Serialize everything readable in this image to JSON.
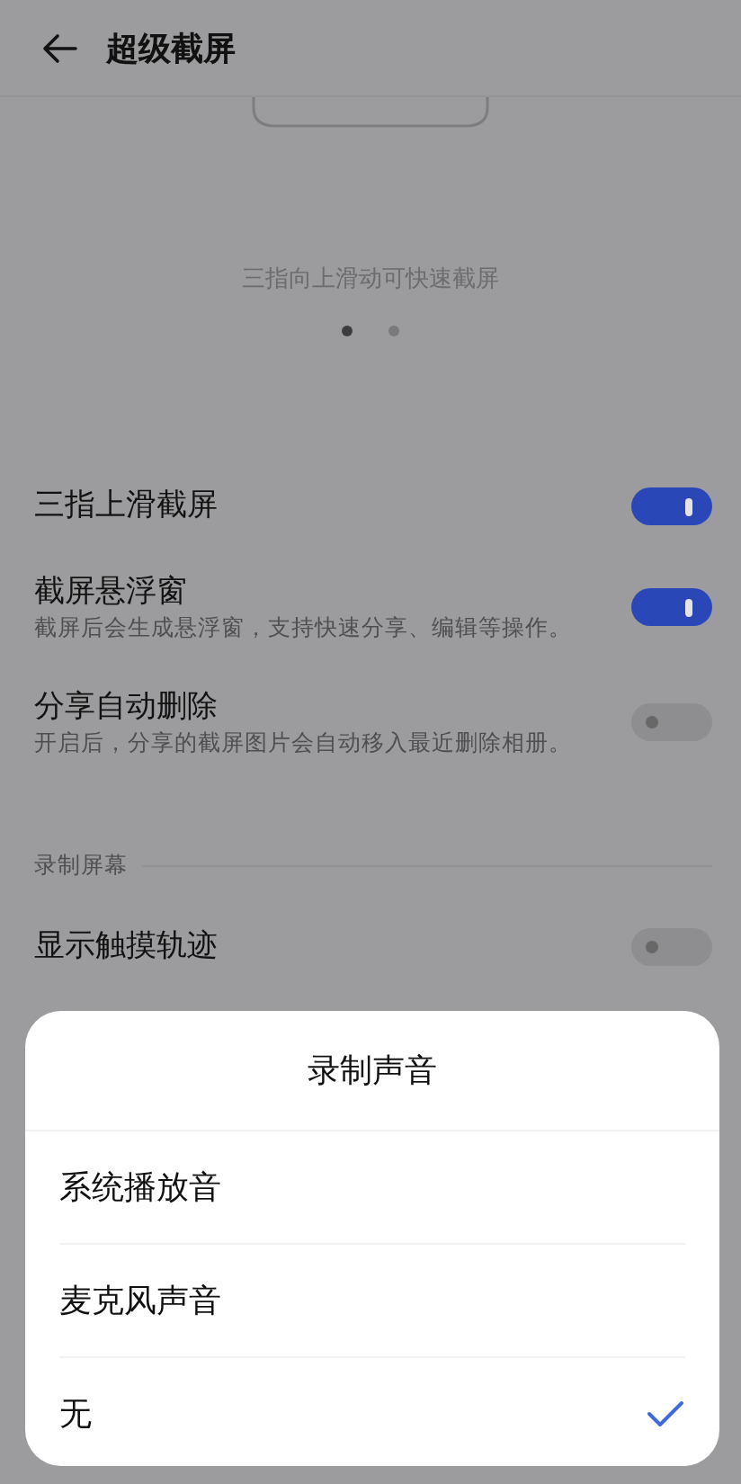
{
  "header": {
    "title": "超级截屏"
  },
  "preview": {
    "caption": "三指向上滑动可快速截屏",
    "pages": [
      {
        "selected": true
      },
      {
        "selected": false
      }
    ]
  },
  "settings": [
    {
      "kind": "toggle",
      "title": "三指上滑截屏",
      "on": true
    },
    {
      "kind": "toggle",
      "title": "截屏悬浮窗",
      "subtitle": "截屏后会生成悬浮窗，支持快速分享、编辑等操作。",
      "on": true
    },
    {
      "kind": "toggle",
      "title": "分享自动删除",
      "subtitle": "开启后，分享的截屏图片会自动移入最近删除相册。",
      "on": false
    },
    {
      "kind": "section",
      "title": "录制屏幕"
    },
    {
      "kind": "toggle",
      "title": "显示触摸轨迹",
      "on": false
    }
  ],
  "sheet": {
    "title": "录制声音",
    "options": [
      {
        "label": "系统播放音",
        "selected": false
      },
      {
        "label": "麦克风声音",
        "selected": false
      },
      {
        "label": "无",
        "selected": true
      }
    ]
  }
}
